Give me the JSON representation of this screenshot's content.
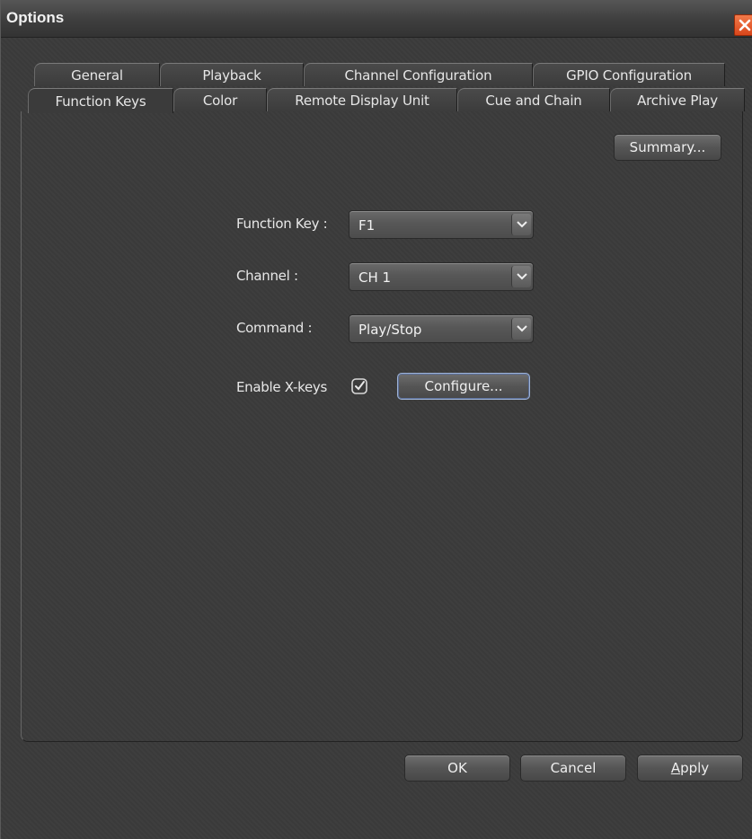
{
  "window": {
    "title": "Options"
  },
  "tabs_row1": [
    {
      "label": "General"
    },
    {
      "label": "Playback"
    },
    {
      "label": "Channel Configuration"
    },
    {
      "label": "GPIO Configuration"
    }
  ],
  "tabs_row2": [
    {
      "label": "Function Keys",
      "active": true
    },
    {
      "label": "Color"
    },
    {
      "label": "Remote Display Unit"
    },
    {
      "label": "Cue and Chain"
    },
    {
      "label": "Archive Play"
    }
  ],
  "panel": {
    "summary_label": "Summary...",
    "function_key": {
      "label": "Function Key :",
      "value": "F1"
    },
    "channel": {
      "label": "Channel :",
      "value": "CH 1"
    },
    "command": {
      "label": "Command :",
      "value": "Play/Stop"
    },
    "xkeys": {
      "label": "Enable X-keys",
      "checked": true,
      "configure_label": "Configure..."
    }
  },
  "footer": {
    "ok_label": "OK",
    "cancel_label": "Cancel",
    "apply_label": "Apply"
  }
}
